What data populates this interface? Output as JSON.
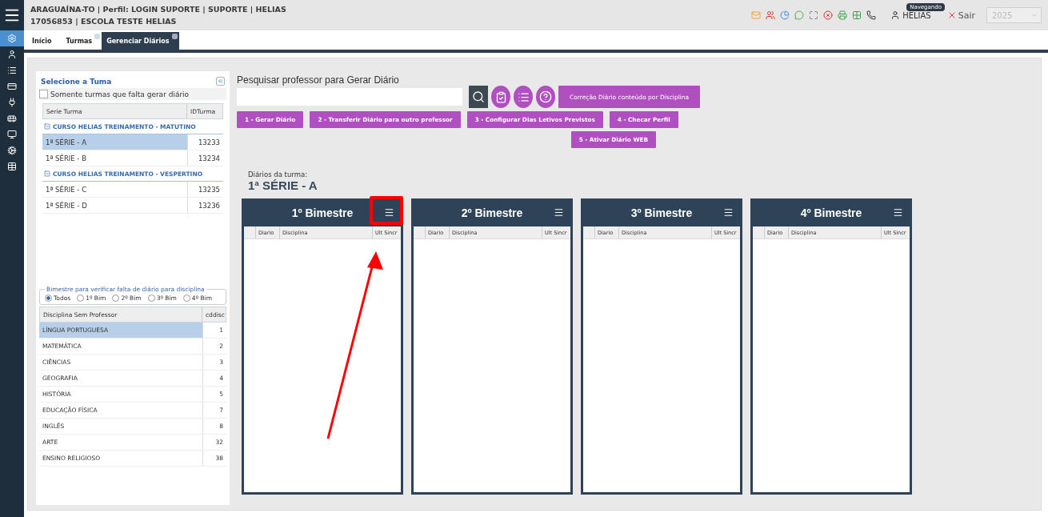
{
  "header": {
    "line_1": "ARAGUAÍNA-TO | Perfil: LOGIN SUPORTE | SUPORTE | HELIAS",
    "line_2": "17056853 | ESCOLA TESTE HELIAS",
    "user": "HELIAS",
    "user_badge": "Navegando",
    "logout": "Sair",
    "year": {
      "value": "2025",
      "disabled": true
    }
  },
  "sidebar": {
    "items": [
      {
        "selected": true
      },
      {
        "selected": false
      },
      {
        "selected": false
      },
      {
        "selected": false
      },
      {
        "selected": false
      },
      {
        "selected": false
      },
      {
        "selected": false
      },
      {
        "selected": false
      },
      {
        "selected": false
      }
    ]
  },
  "tabs": [
    {
      "label": "Início",
      "selected": false,
      "closable": false
    },
    {
      "label": "Turmas",
      "selected": false,
      "closable": true
    },
    {
      "label": "Gerenciar Diários",
      "selected": true,
      "closable": true
    }
  ],
  "left_panel": {
    "title": "Selecione a Tuma",
    "only_missing": {
      "label": "Somente turmas que falta gerar diário",
      "checked": false
    },
    "classes_table": {
      "columns": [
        "Serie Turma",
        "IDTurma"
      ],
      "groups": [
        {
          "label": "CURSO HELIAS TREINAMENTO - MATUTINO",
          "rows": [
            {
              "name": "1ª SÉRIE - A",
              "id": "13233",
              "selected": true
            },
            {
              "name": "1ª SÉRIE - B",
              "id": "13234",
              "selected": false
            }
          ]
        },
        {
          "label": "CURSO HELIAS TREINAMENTO - VESPERTINO",
          "rows": [
            {
              "name": "1ª SÉRIE - C",
              "id": "13235",
              "selected": false
            },
            {
              "name": "1ª SÉRIE - D",
              "id": "13236",
              "selected": false
            }
          ]
        }
      ]
    },
    "bimester_filter": {
      "legend": "Bimestre para verificar falta de diário para disciplina",
      "options": [
        {
          "label": "Todos",
          "selected": true
        },
        {
          "label": "1º Bim",
          "selected": false
        },
        {
          "label": "2º Bim",
          "selected": false
        },
        {
          "label": "3º Bim",
          "selected": false
        },
        {
          "label": "4º Bim",
          "selected": false
        }
      ]
    },
    "subjects_table": {
      "columns": [
        "Disciplina Sem Professor",
        "cddisc"
      ],
      "rows": [
        {
          "name": "LÍNGUA PORTUGUESA",
          "code": "1",
          "selected": true
        },
        {
          "name": "MATEMÁTICA",
          "code": "2",
          "selected": false
        },
        {
          "name": "CIÊNCIAS",
          "code": "3",
          "selected": false
        },
        {
          "name": "GEOGRAFIA",
          "code": "4",
          "selected": false
        },
        {
          "name": "HISTÓRIA",
          "code": "5",
          "selected": false
        },
        {
          "name": "EDUCAÇÃO FÍSICA",
          "code": "7",
          "selected": false
        },
        {
          "name": "INGLÊS",
          "code": "8",
          "selected": false
        },
        {
          "name": "ARTE",
          "code": "32",
          "selected": false
        },
        {
          "name": "ENSINO RELIGIOSO",
          "code": "38",
          "selected": false
        }
      ]
    }
  },
  "search": {
    "label": "Pesquisar professor para Gerar Diário",
    "correction_button": "Correção Diário conteúdo por Disciplina"
  },
  "action_buttons": [
    [
      "1 - Gerar Diário",
      "2 - Transferir Diário para outro professor",
      "3 - Configurar Dias Letivos Previstos",
      "4 - Checar Perfil"
    ],
    [
      "5 - Ativar Diário WEB"
    ]
  ],
  "class_diaries": {
    "label": "Diários da turma:",
    "class_name": "1ª SÉRIE - A"
  },
  "bimesters": [
    {
      "title": "1º Bimestre",
      "columns": [
        "Diario",
        "Disciplina",
        "Ult Sincr"
      ],
      "highlighted": true
    },
    {
      "title": "2º Bimestre",
      "columns": [
        "Diario",
        "Disciplina",
        "Ult Sincr"
      ],
      "highlighted": false
    },
    {
      "title": "3º Bimestre",
      "columns": [
        "Diario",
        "Disciplina",
        "Ult Sincr"
      ],
      "highlighted": false
    },
    {
      "title": "4º Bimestre",
      "columns": [
        "Diario",
        "Disciplina",
        "Ult Sincr"
      ],
      "highlighted": false
    }
  ]
}
